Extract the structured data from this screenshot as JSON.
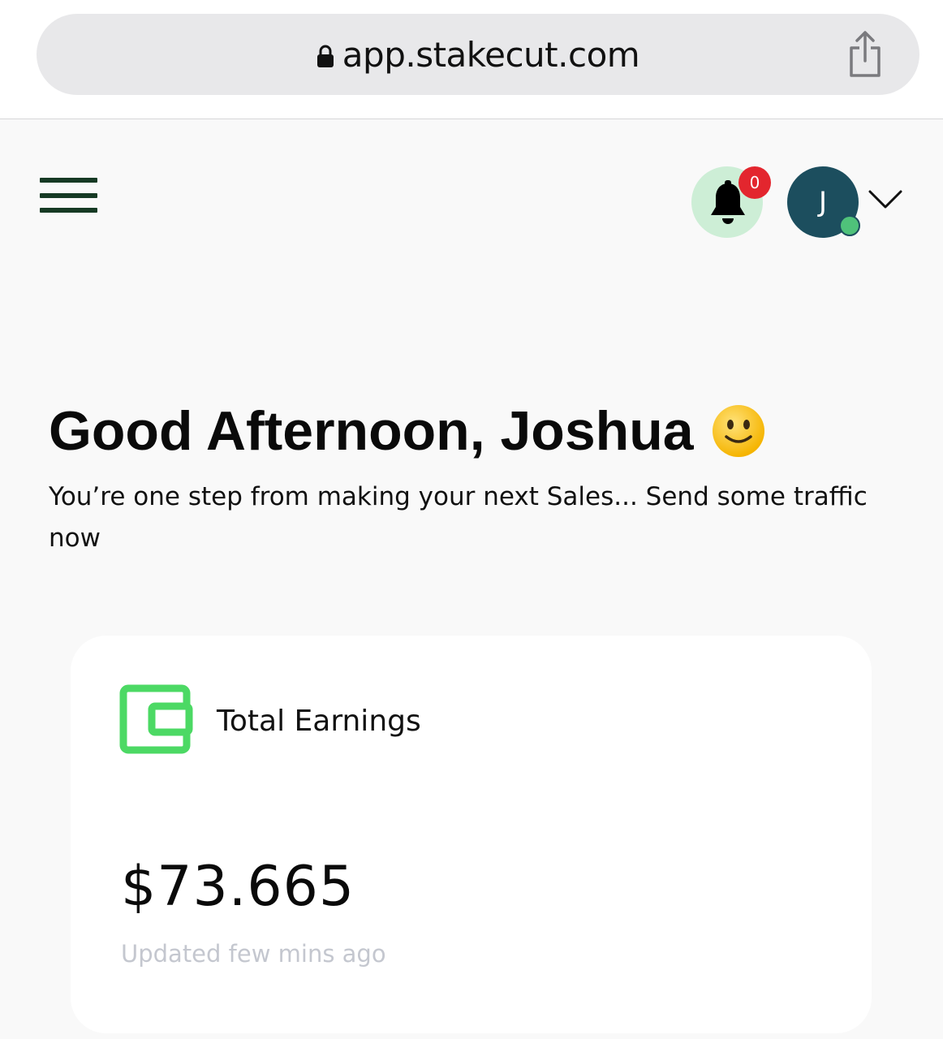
{
  "browser": {
    "url": "app.stakecut.com",
    "lock_icon": "lock-icon",
    "share_icon": "share-icon"
  },
  "header": {
    "menu_icon": "hamburger-menu-icon",
    "notifications": {
      "icon": "bell-icon",
      "count": "0",
      "badge_color": "#e3262e",
      "bg_color": "#cdeed6"
    },
    "user": {
      "initial": "J",
      "avatar_color": "#1c4e5e",
      "status_color": "#4fc27a",
      "dropdown_icon": "chevron-down-icon"
    }
  },
  "main": {
    "greeting": "Good Afternoon, Joshua",
    "greeting_emoji": "slightly-smiling-face-icon",
    "subtitle": "You’re one step from making your next Sales... Send some traffic now"
  },
  "earnings_card": {
    "icon": "wallet-icon",
    "icon_color": "#4cd964",
    "label": "Total Earnings",
    "amount": "$73.665",
    "updated": "Updated few mins ago"
  }
}
